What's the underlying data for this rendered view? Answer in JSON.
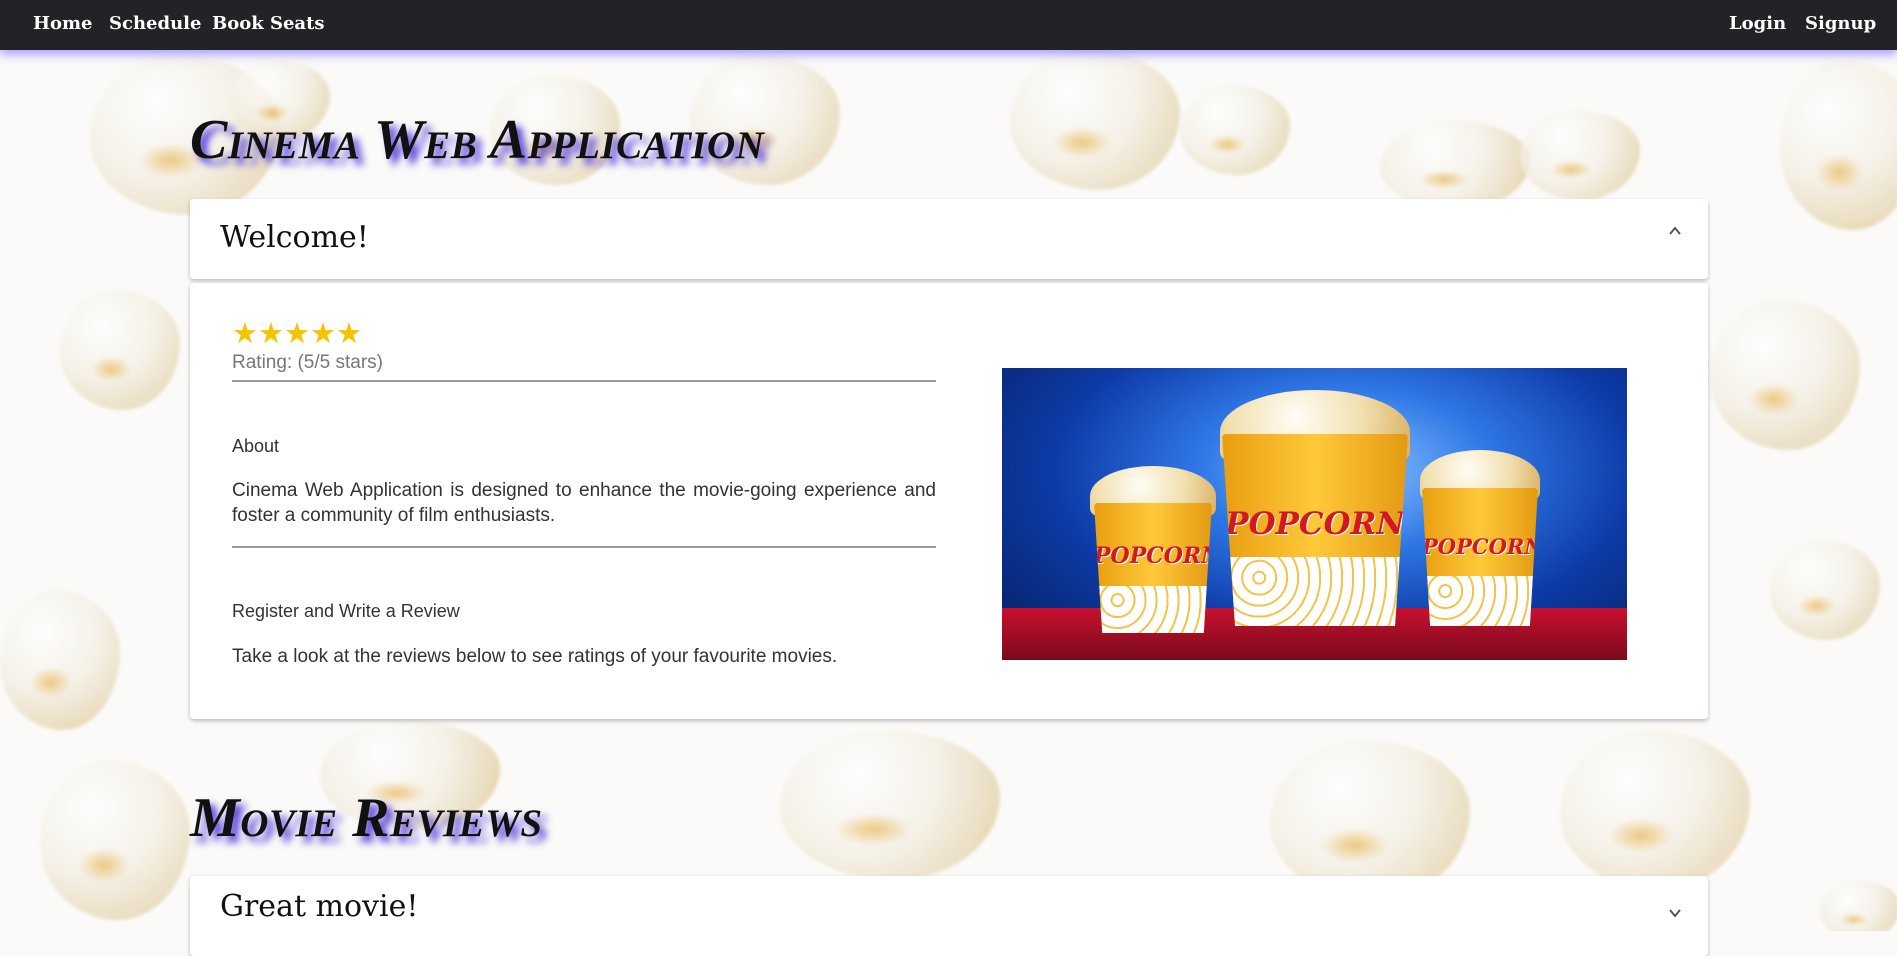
{
  "nav": {
    "left_links": [
      "Home",
      "Schedule",
      "Book Seats"
    ],
    "right_links": [
      "Login",
      "Signup"
    ]
  },
  "app_title": "Cinema Web Application",
  "welcome_card": {
    "title": "Welcome!",
    "expanded": true,
    "stars": "★★★★★",
    "rating_value": 5,
    "rating_max": 5,
    "rating_text": "Rating: (5/5 stars)",
    "about_heading": "About",
    "about_text": "Cinema Web Application is designed to enhance the movie-going experience and foster a community of film enthusiasts.",
    "register_heading": "Register and Write a Review",
    "register_text": "Take a look at the reviews below to see ratings of your favourite movies.",
    "image_text": {
      "bucket_left": "POPCORN",
      "bucket_center": "POPCORN",
      "bucket_right": "POPCORN"
    }
  },
  "reviews_title": "Movie Reviews",
  "review_cards": [
    {
      "title": "Great movie!",
      "expanded": false
    }
  ],
  "colors": {
    "navbar_bg": "#222326",
    "nav_glow": "#5a46ff",
    "title_shadow": "#4b34d8",
    "star": "#f5c400"
  },
  "icons": {
    "collapse": "chevron-up-icon",
    "expand": "chevron-down-icon"
  }
}
